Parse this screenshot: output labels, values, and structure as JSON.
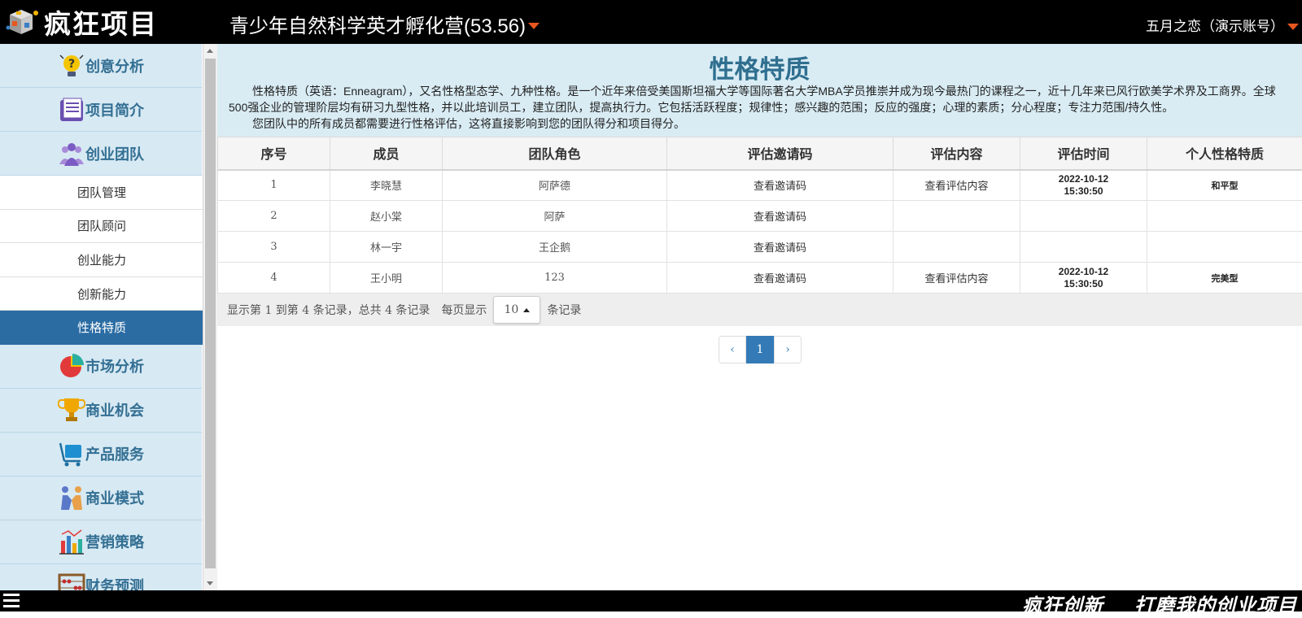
{
  "header": {
    "logo_text": "疯狂项目",
    "project_title": "青少年自然科学英才孵化营(53.56)",
    "user": "五月之恋（演示账号）"
  },
  "sidebar": {
    "items": [
      {
        "label": "创意分析",
        "icon": "lightbulb-question-icon"
      },
      {
        "label": "项目简介",
        "icon": "document-icon"
      },
      {
        "label": "创业团队",
        "icon": "team-people-icon"
      }
    ],
    "sub_items": [
      {
        "label": "团队管理"
      },
      {
        "label": "团队顾问"
      },
      {
        "label": "创业能力"
      },
      {
        "label": "创新能力"
      },
      {
        "label": "性格特质",
        "active": true
      }
    ],
    "items_after": [
      {
        "label": "市场分析",
        "icon": "pie-chart-icon"
      },
      {
        "label": "商业机会",
        "icon": "trophy-icon"
      },
      {
        "label": "产品服务",
        "icon": "cart-icon"
      },
      {
        "label": "商业模式",
        "icon": "handshake-icon"
      },
      {
        "label": "营销策略",
        "icon": "bar-chart-icon"
      },
      {
        "label": "财务预测",
        "icon": "abacus-icon"
      }
    ]
  },
  "main": {
    "title": "性格特质",
    "description": "性格特质（英语：Enneagram），又名性格型态学、九种性格。是一个近年来倍受美国斯坦福大学等国际著名大学MBA学员推崇并成为现今最热门的课程之一，近十几年来已风行欧美学术界及工商界。全球500强企业的管理阶层均有研习九型性格，并以此培训员工，建立团队，提高执行力。它包括活跃程度；规律性；感兴趣的范围；反应的强度；心理的素质；分心程度；专注力范围/持久性。",
    "note": "您团队中的所有成员都需要进行性格评估，这将直接影响到您的团队得分和项目得分。"
  },
  "table": {
    "headers": [
      "序号",
      "成员",
      "团队角色",
      "评估邀请码",
      "评估内容",
      "评估时间",
      "个人性格特质"
    ],
    "rows": [
      {
        "no": "1",
        "member": "李晓慧",
        "role": "阿萨德",
        "invite": "查看邀请码",
        "content": "查看评估内容",
        "date": "2022-10-12",
        "time": "15:30:50",
        "trait": "和平型"
      },
      {
        "no": "2",
        "member": "赵小棠",
        "role": "阿萨",
        "invite": "查看邀请码",
        "content": "",
        "date": "",
        "time": "",
        "trait": ""
      },
      {
        "no": "3",
        "member": "林一宇",
        "role": "王企鹅",
        "invite": "查看邀请码",
        "content": "",
        "date": "",
        "time": "",
        "trait": ""
      },
      {
        "no": "4",
        "member": "王小明",
        "role": "123",
        "invite": "查看邀请码",
        "content": "查看评估内容",
        "date": "2022-10-12",
        "time": "15:30:50",
        "trait": "完美型"
      }
    ]
  },
  "pagination": {
    "summary": "显示第 1 到第 4 条记录，总共 4 条记录",
    "per_page_prefix": "每页显示",
    "page_size": "10",
    "per_page_suffix": "条记录",
    "prev": "‹",
    "current": "1",
    "next": "›"
  },
  "footer": {
    "slogan_1": "疯狂创新",
    "slogan_2": "打磨我的创业项目"
  }
}
